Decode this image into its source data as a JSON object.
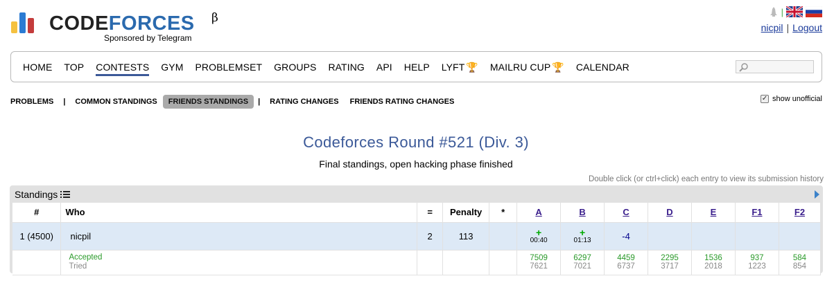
{
  "logo": {
    "text_prefix": "CODE",
    "text_suffix": "FORCES",
    "beta": "β",
    "sponsor": "Sponsored by Telegram",
    "bar_colors": [
      "#f5c140",
      "#2b7bd3",
      "#c43c3c"
    ],
    "code_color": "#222222",
    "forces_color": "#2b6aae"
  },
  "header": {
    "username": "nicpil",
    "separator": "|",
    "logout": "Logout",
    "lang_separator": "|"
  },
  "menu": {
    "items": [
      {
        "label": "HOME"
      },
      {
        "label": "TOP"
      },
      {
        "label": "CONTESTS",
        "active": true
      },
      {
        "label": "GYM"
      },
      {
        "label": "PROBLEMSET"
      },
      {
        "label": "GROUPS"
      },
      {
        "label": "RATING"
      },
      {
        "label": "API"
      },
      {
        "label": "HELP"
      },
      {
        "label": "LYFT",
        "trophy": true
      },
      {
        "label": "MAILRU CUP",
        "trophy": true
      },
      {
        "label": "CALENDAR"
      }
    ]
  },
  "subnav": {
    "problems": "PROBLEMS",
    "common": "COMMON STANDINGS",
    "friends": "FRIENDS STANDINGS",
    "pipe": "|",
    "rating_changes": "RATING CHANGES",
    "friends_rating_changes": "FRIENDS RATING CHANGES",
    "show_unofficial": "show unofficial",
    "checkmark": "✓"
  },
  "contest": {
    "title": "Codeforces Round #521 (Div. 3)",
    "status": "Final standings, open hacking phase finished",
    "hint": "Double click (or ctrl+click) each entry to view its submission history"
  },
  "standings": {
    "title": "Standings",
    "headers": {
      "rank": "#",
      "who": "Who",
      "solved": "=",
      "penalty": "Penalty",
      "hacks": "*",
      "problems": [
        "A",
        "B",
        "C",
        "D",
        "E",
        "F1",
        "F2"
      ]
    },
    "row": {
      "rank": "1 (4500)",
      "handle": "nicpil",
      "solved": "2",
      "penalty": "113",
      "cells": [
        {
          "mark": "+",
          "time": "00:40"
        },
        {
          "mark": "+",
          "time": "01:13"
        },
        {
          "mark": "-4",
          "time": ""
        },
        {
          "mark": "",
          "time": ""
        },
        {
          "mark": "",
          "time": ""
        },
        {
          "mark": "",
          "time": ""
        },
        {
          "mark": "",
          "time": ""
        }
      ]
    },
    "summary": {
      "accepted_label": "Accepted",
      "tried_label": "Tried",
      "accepted": [
        "7509",
        "6297",
        "4459",
        "2295",
        "1536",
        "937",
        "584"
      ],
      "tried": [
        "7621",
        "7021",
        "6737",
        "3717",
        "2018",
        "1223",
        "854"
      ]
    }
  }
}
